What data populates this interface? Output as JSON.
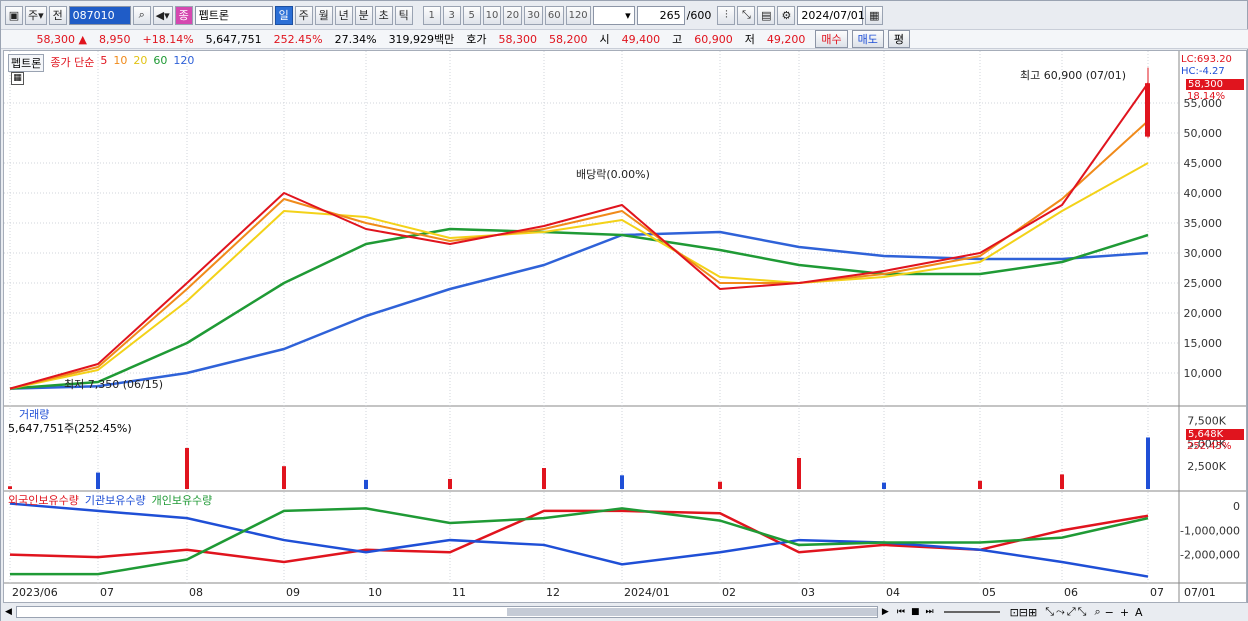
{
  "toolbar": {
    "period": "주",
    "prev": "전",
    "code": "087010",
    "name": "펩트론",
    "tf": [
      "일",
      "주",
      "월",
      "년",
      "분",
      "초",
      "틱"
    ],
    "nums": [
      "1",
      "3",
      "5",
      "10",
      "20",
      "30",
      "60",
      "120"
    ],
    "count": "265",
    "total": "/600",
    "date": "2024/07/01"
  },
  "quote": {
    "price": "58,300",
    "arrow": "▲",
    "change": "8,950",
    "pct": "+18.14%",
    "volume": "5,647,751",
    "vol_ratio": "252.45%",
    "turnover": "27.34%",
    "amount": "319,929백만",
    "bid_label": "호가",
    "ask": "58,300",
    "bid": "58,200",
    "open_label": "시",
    "open": "49,400",
    "high_label": "고",
    "high": "60,900",
    "low_label": "저",
    "low": "49,200",
    "buy": "매수",
    "sell": "매도",
    "avg": "평"
  },
  "legend": {
    "name": "펩트론",
    "type": "종가 단순",
    "ma": [
      "5",
      "10",
      "20",
      "60",
      "120"
    ]
  },
  "right_labels": {
    "lc": "LC:693.20",
    "hc": "HC:-4.27",
    "price": "58,300",
    "pct": "18.14%",
    "vol_now": "5,648K",
    "vol_pct": "252.45%"
  },
  "annotations": {
    "high": "최고 60,900 (07/01)",
    "low": "최저 7,350 (06/15)",
    "div": "배당락(0.00%)"
  },
  "volume": {
    "title": "거래량",
    "readout": "5,647,751주(252.45%)"
  },
  "holdings": {
    "foreign": "외국인보유수량",
    "inst": "기관보유수량",
    "indiv": "개인보유수량"
  },
  "colors": {
    "up": "#e0141e",
    "down": "#1f4fd6",
    "ma5": "#e0141e",
    "ma10": "#f08a1a",
    "ma20": "#f3d219",
    "ma60": "#1f9a35",
    "ma120": "#2f62d8"
  },
  "chart_data": [
    {
      "type": "line",
      "title": "펩트론",
      "x_ticks": [
        "2023/06",
        "07",
        "08",
        "09",
        "10",
        "11",
        "12",
        "2024/01",
        "02",
        "03",
        "04",
        "05",
        "06",
        "07",
        "07/01"
      ],
      "y_ticks": [
        10000,
        15000,
        20000,
        25000,
        30000,
        35000,
        40000,
        45000,
        50000,
        55000
      ],
      "ylim": [
        5000,
        62000
      ],
      "series": [
        {
          "name": "5",
          "x": [
            "2023/06",
            "07",
            "08",
            "09",
            "10",
            "11",
            "12",
            "2024/01",
            "02",
            "03",
            "04",
            "05",
            "06",
            "07"
          ],
          "values": [
            7400,
            11500,
            25000,
            40000,
            34000,
            31500,
            34500,
            38000,
            24000,
            25000,
            27000,
            30000,
            38000,
            58300
          ]
        },
        {
          "name": "10",
          "x": [
            "2023/06",
            "07",
            "08",
            "09",
            "10",
            "11",
            "12",
            "2024/01",
            "02",
            "03",
            "04",
            "05",
            "06",
            "07"
          ],
          "values": [
            7400,
            11000,
            24000,
            39000,
            35000,
            32000,
            34000,
            37000,
            25000,
            25000,
            26500,
            29500,
            39000,
            52000
          ]
        },
        {
          "name": "20",
          "x": [
            "2023/06",
            "07",
            "08",
            "09",
            "10",
            "11",
            "12",
            "2024/01",
            "02",
            "03",
            "04",
            "05",
            "06",
            "07"
          ],
          "values": [
            7400,
            10500,
            22000,
            37000,
            36000,
            32500,
            33500,
            35500,
            26000,
            25000,
            26000,
            28500,
            37000,
            45000
          ]
        },
        {
          "name": "60",
          "x": [
            "2023/06",
            "07",
            "08",
            "09",
            "10",
            "11",
            "12",
            "2024/01",
            "02",
            "03",
            "04",
            "05",
            "06",
            "07"
          ],
          "values": [
            7400,
            8500,
            15000,
            25000,
            31500,
            34000,
            33500,
            33000,
            30500,
            28000,
            26500,
            26500,
            28500,
            33000
          ]
        },
        {
          "name": "120",
          "x": [
            "2023/06",
            "07",
            "08",
            "09",
            "10",
            "11",
            "12",
            "2024/01",
            "02",
            "03",
            "04",
            "05",
            "06",
            "07"
          ],
          "values": [
            7400,
            7800,
            10000,
            14000,
            19500,
            24000,
            28000,
            33000,
            33500,
            31000,
            29500,
            29000,
            29000,
            30000
          ]
        }
      ]
    },
    {
      "type": "bar",
      "title": "거래량",
      "y_ticks": [
        "2,500K",
        "5,000K",
        "7,500K"
      ],
      "ylim": [
        0,
        8000
      ],
      "categories": [
        "2023/06",
        "07",
        "08",
        "09",
        "10",
        "11",
        "12",
        "2024/01",
        "02",
        "03",
        "04",
        "05",
        "06",
        "07"
      ],
      "values": [
        300,
        1800,
        4500,
        2500,
        1000,
        1100,
        2300,
        1500,
        800,
        3400,
        700,
        900,
        1600,
        5648
      ]
    },
    {
      "type": "line",
      "y_ticks": [
        "0",
        "-1,000,000",
        "-2,000,000"
      ],
      "x": [
        "2023/06",
        "07",
        "08",
        "09",
        "10",
        "11",
        "12",
        "2024/01",
        "02",
        "03",
        "04",
        "05",
        "06",
        "07"
      ],
      "series": [
        {
          "name": "외국인보유수량",
          "values": [
            -2000000,
            -2100000,
            -1800000,
            -2300000,
            -1800000,
            -1900000,
            -200000,
            -200000,
            -300000,
            -1900000,
            -1600000,
            -1800000,
            -1000000,
            -400000
          ]
        },
        {
          "name": "기관보유수량",
          "values": [
            100000,
            -200000,
            -500000,
            -1400000,
            -1900000,
            -1400000,
            -1600000,
            -2400000,
            -1900000,
            -1400000,
            -1500000,
            -1800000,
            -2300000,
            -2900000
          ]
        },
        {
          "name": "개인보유수량",
          "values": [
            -2800000,
            -2800000,
            -2200000,
            -200000,
            -100000,
            -700000,
            -500000,
            -100000,
            -600000,
            -1600000,
            -1500000,
            -1500000,
            -1300000,
            -500000
          ]
        }
      ]
    }
  ]
}
